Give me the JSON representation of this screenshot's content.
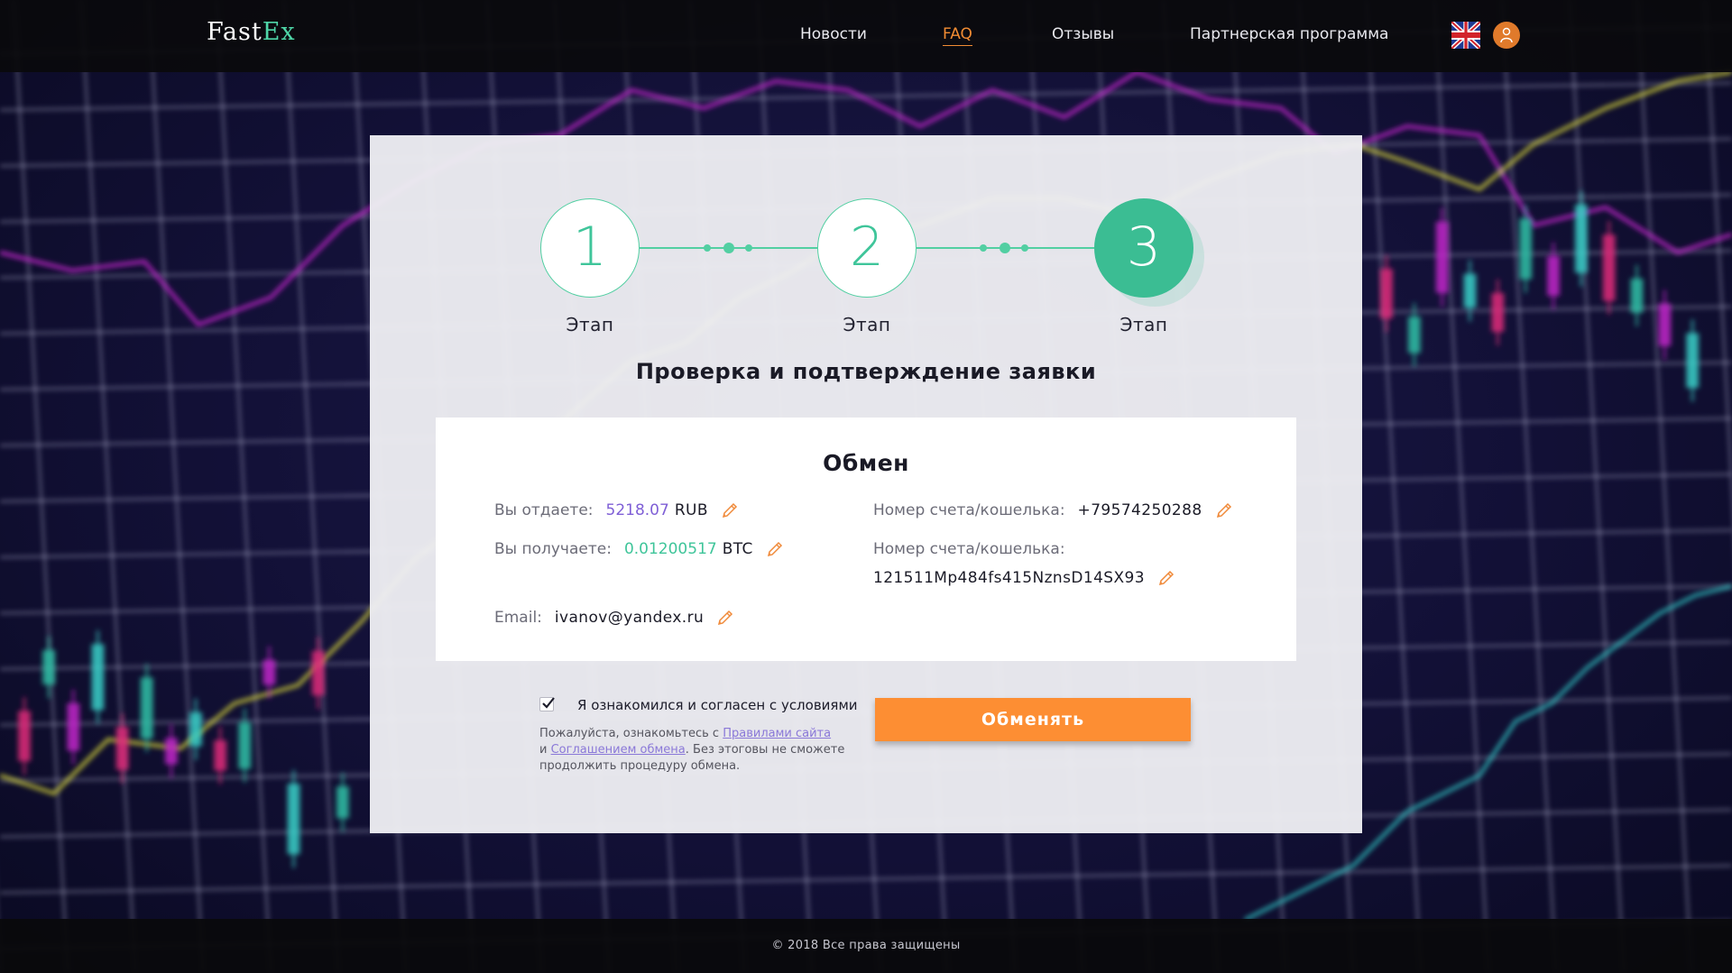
{
  "header": {
    "logo_fast": "Fast",
    "logo_ex": "Ex",
    "nav": [
      "Новости",
      "FAQ",
      "Отзывы",
      "Партнерская программа"
    ],
    "active_nav": "FAQ",
    "language_icon": "uk-flag-icon",
    "user_icon": "user-icon"
  },
  "steps": [
    {
      "number": "1",
      "label": "Этап",
      "state": "idle"
    },
    {
      "number": "2",
      "label": "Этап",
      "state": "idle"
    },
    {
      "number": "3",
      "label": "Этап",
      "state": "active"
    }
  ],
  "card": {
    "title": "Проверка и подтверждение заявки"
  },
  "exchange": {
    "title": "Обмен",
    "give_label": "Вы отдаете:",
    "give_amount": "5218.07",
    "give_currency": "RUB",
    "receive_label": "Вы получаете:",
    "receive_amount": "0.01200517",
    "receive_currency": "BTC",
    "email_label": "Email:",
    "email_value": "ivanov@yandex.ru",
    "account_label_1": "Номер счета/кошелька:",
    "account_value_1": "+79574250288",
    "account_label_2": "Номер счета/кошелька:",
    "account_value_2": "121511Mp484fs415NznsD14SX93",
    "edit_icon": "pencil-icon"
  },
  "agreement": {
    "checked": true,
    "label": "Я ознакомился и согласен с условиями",
    "notice_before": "Пожалуйста, ознакомьтесь с ",
    "rules_link": "Правилами сайта",
    "and": "и ",
    "agreement_link": "Соглашением обмена",
    "notice_after": ". Без этоговы не сможете продолжить процедуру обмена."
  },
  "submit_label": "Обменять",
  "footer": {
    "copyright": "© 2018 Все права защищены"
  },
  "colors": {
    "accent_green": "#3fc59a",
    "accent_orange": "#fd8e33",
    "amount_purple": "#7f5fd6"
  }
}
